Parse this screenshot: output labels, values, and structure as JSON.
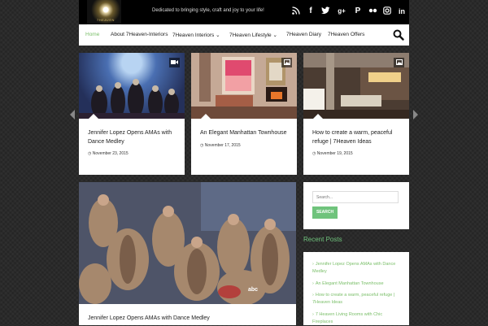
{
  "header": {
    "logo_text": "7HEAVEN",
    "tagline": "Dedicated to bringing style, craft and joy to your life!",
    "social_icons": [
      "rss-icon",
      "facebook-icon",
      "twitter-icon",
      "google-plus-icon",
      "pinterest-icon",
      "flickr-icon",
      "instagram-icon",
      "linkedin-icon"
    ]
  },
  "nav": {
    "items": [
      {
        "label": "Home",
        "active": true
      },
      {
        "label": "About 7Heaven-Interiors"
      },
      {
        "label": "7Heaven Interiors ⌄"
      },
      {
        "label": "7Heaven Lifestyle ⌄"
      },
      {
        "label": "7Heaven Diary"
      },
      {
        "label": "7Heaven Offers"
      }
    ]
  },
  "slider": {
    "cards": [
      {
        "title": "Jennifer Lopez Opens AMAs with Dance Medley",
        "date": "November 23, 2015",
        "format_icon": "video-icon"
      },
      {
        "title": "An Elegant Manhattan Townhouse",
        "date": "November 17, 2015",
        "format_icon": "image-icon"
      },
      {
        "title": "How to create a warm, peaceful refuge | 7Heaven Ideas",
        "date": "November 19, 2015",
        "format_icon": "image-icon"
      }
    ]
  },
  "featured": {
    "title": "Jennifer Lopez Opens AMAs with Dance Medley"
  },
  "sidebar": {
    "search_placeholder": "Search...",
    "search_button": "SEARCH",
    "recent_posts_title": "Recent Posts",
    "recent_posts": [
      "Jennifer Lopez Opens AMAs with Dance Medley",
      "An Elegant Manhattan Townhouse",
      "How to create a warm, peaceful refuge | 7Heaven Ideas",
      "7 Heaven Living Rooms with Chic Fireplaces"
    ]
  },
  "colors": {
    "accent": "#6fc37c",
    "topbar": "#000000"
  }
}
